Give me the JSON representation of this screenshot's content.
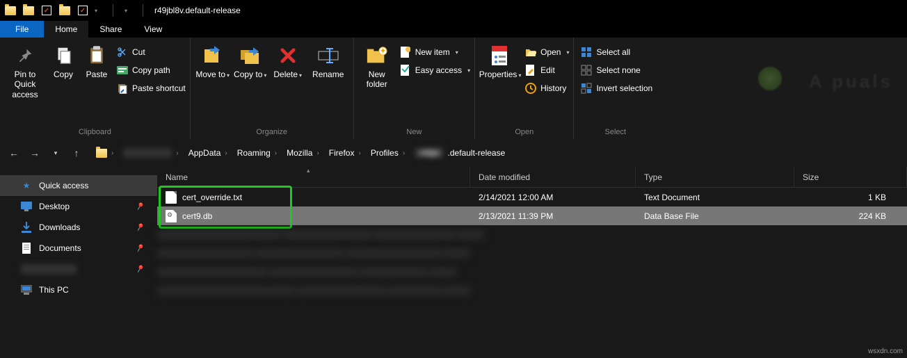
{
  "title": "r49jbl8v.default-release",
  "menu": {
    "file": "File",
    "home": "Home",
    "share": "Share",
    "view": "View"
  },
  "ribbon": {
    "clipboard": {
      "label": "Clipboard",
      "pin": "Pin to Quick access",
      "copy": "Copy",
      "paste": "Paste",
      "cut": "Cut",
      "copypath": "Copy path",
      "pasteshort": "Paste shortcut"
    },
    "organize": {
      "label": "Organize",
      "moveto": "Move to",
      "copyto": "Copy to",
      "delete": "Delete",
      "rename": "Rename"
    },
    "new": {
      "label": "New",
      "newfolder": "New folder",
      "newitem": "New item",
      "easyaccess": "Easy access"
    },
    "open": {
      "label": "Open",
      "properties": "Properties",
      "open": "Open",
      "edit": "Edit",
      "history": "History"
    },
    "select": {
      "label": "Select",
      "all": "Select all",
      "none": "Select none",
      "invert": "Invert selection"
    }
  },
  "breadcrumb": [
    "AppData",
    "Roaming",
    "Mozilla",
    "Firefox",
    "Profiles",
    ".default-release"
  ],
  "breadcrumb_prefix_blurred": true,
  "sidebar": [
    {
      "label": "Quick access",
      "icon": "star",
      "active": true
    },
    {
      "label": "Desktop",
      "icon": "desktop",
      "pin": true
    },
    {
      "label": "Downloads",
      "icon": "download",
      "pin": true
    },
    {
      "label": "Documents",
      "icon": "document",
      "pin": true
    },
    {
      "label": "",
      "blurred": true,
      "pin": true
    },
    {
      "label": "This PC",
      "icon": "pc"
    }
  ],
  "columns": {
    "name": "Name",
    "date": "Date modified",
    "type": "Type",
    "size": "Size"
  },
  "files": [
    {
      "name": "cert_override.txt",
      "date": "2/14/2021 12:00 AM",
      "type": "Text Document",
      "size": "1 KB",
      "selected": false,
      "icon": "txt"
    },
    {
      "name": "cert9.db",
      "date": "2/13/2021 11:39 PM",
      "type": "Data Base File",
      "size": "224 KB",
      "selected": true,
      "icon": "db"
    }
  ],
  "watermark": "wsxdn.com"
}
